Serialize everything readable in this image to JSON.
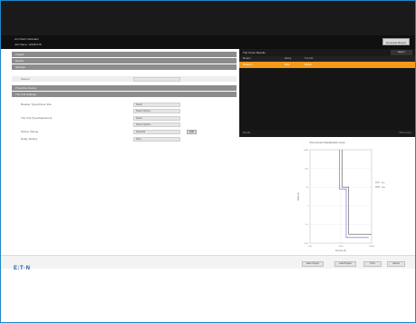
{
  "header": {
    "app_title": "Arc Flash Calculator",
    "subtitle": "Job Name: 12345-678",
    "top_button": "Generate Report"
  },
  "left_panel": {
    "sections": [
      {
        "label": "Project"
      },
      {
        "label": "Device"
      },
      {
        "label": "Settings"
      }
    ],
    "general_label": "Source",
    "subsections": [
      {
        "label": "Protective Device"
      },
      {
        "label": "Trip Unit Settings"
      }
    ],
    "fields": [
      {
        "label": "Breaker Type/Frame Size",
        "value": "Select",
        "value2": "Select Options"
      },
      {
        "label": "Trip Unit Type/Adjustment",
        "value": "Select",
        "value2": "Select Options"
      },
      {
        "label": "Pickup Setting",
        "value": "Standard",
        "button": "Edit"
      },
      {
        "label": "Delay Setting",
        "value": "None"
      }
    ]
  },
  "right_panel": {
    "title": "Trip Curve Results",
    "header_button": "Export",
    "table_headers": [
      "Breaker",
      "Rating",
      "Trip Unit"
    ],
    "selected_row": [
      "Breaker 1",
      "800A",
      "Digitrip"
    ],
    "footer_left": "Results",
    "footer_right": "Show Curve"
  },
  "chart_data": {
    "type": "line",
    "title": "Time-Current Characteristic Curve",
    "xlabel": "Current (A)",
    "ylabel": "Time (s)",
    "x_ticks": [
      "100",
      "1000",
      "10000"
    ],
    "y_ticks": [
      "1000",
      "100",
      "10",
      "1",
      "0.1",
      "0.01"
    ],
    "legend": [
      "Min",
      "Max"
    ],
    "series": [
      {
        "name": "Min",
        "x": [
          900,
          900,
          1500,
          1500,
          8000
        ],
        "y": [
          1000,
          8,
          8,
          0.02,
          0.02
        ]
      },
      {
        "name": "Max",
        "x": [
          1100,
          1100,
          1800,
          1800,
          10000
        ],
        "y": [
          1000,
          10,
          10,
          0.03,
          0.03
        ]
      }
    ]
  },
  "brand": {
    "logo_text": "E:T·N",
    "accent": "#f29a1a",
    "brand_color": "#1c5aa8"
  },
  "footer": {
    "buttons": [
      "Save Project",
      "Load Project",
      "Print",
      "Cancel"
    ]
  }
}
